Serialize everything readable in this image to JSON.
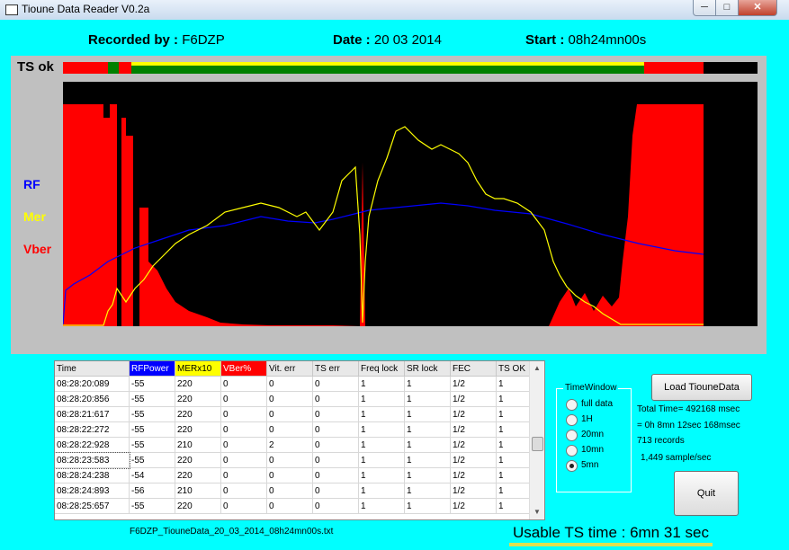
{
  "window": {
    "title": "Tioune Data Reader V0.2a",
    "min_icon": "minimize-icon",
    "max_icon": "maximize-icon",
    "close_icon": "close-icon"
  },
  "header": {
    "recorded_by_label": "Recorded by :",
    "recorded_by_value": "F6DZP",
    "date_label": "Date :",
    "date_value": "20 03 2014",
    "start_label": "Start :",
    "start_value": "08h24mn00s"
  },
  "plot": {
    "ts_label": "TS ok",
    "rf_label": "RF",
    "mer_label": "Mer",
    "vber_label": "Vber",
    "colors": {
      "rf": "#0000ff",
      "mer": "#ffff00",
      "vber": "#ff0000",
      "bg": "#000000",
      "ts_ok": "#008000",
      "ts_bad": "#ff0000"
    }
  },
  "table": {
    "headers": [
      "Time",
      "RFPower",
      "MERx10",
      "VBer%",
      "Vit. err",
      "TS err",
      "Freq lock",
      "SR lock",
      "FEC",
      "TS OK"
    ],
    "header_colors": [
      "",
      "#0000ff",
      "#ffff00",
      "#ff0000",
      "",
      "",
      "",
      "",
      "",
      ""
    ],
    "rows": [
      [
        "08:28:20:089",
        "-55",
        "220",
        "0",
        "0",
        "0",
        "1",
        "1",
        "1/2",
        "1"
      ],
      [
        "08:28:20:856",
        "-55",
        "220",
        "0",
        "0",
        "0",
        "1",
        "1",
        "1/2",
        "1"
      ],
      [
        "08:28:21:617",
        "-55",
        "220",
        "0",
        "0",
        "0",
        "1",
        "1",
        "1/2",
        "1"
      ],
      [
        "08:28:22:272",
        "-55",
        "220",
        "0",
        "0",
        "0",
        "1",
        "1",
        "1/2",
        "1"
      ],
      [
        "08:28:22:928",
        "-55",
        "210",
        "0",
        "2",
        "0",
        "1",
        "1",
        "1/2",
        "1"
      ],
      [
        "08:28:23:583",
        "-55",
        "220",
        "0",
        "0",
        "0",
        "1",
        "1",
        "1/2",
        "1"
      ],
      [
        "08:28:24:238",
        "-54",
        "220",
        "0",
        "0",
        "0",
        "1",
        "1",
        "1/2",
        "1"
      ],
      [
        "08:28:24:893",
        "-56",
        "210",
        "0",
        "0",
        "0",
        "1",
        "1",
        "1/2",
        "1"
      ],
      [
        "08:28:25:657",
        "-55",
        "220",
        "0",
        "0",
        "0",
        "1",
        "1",
        "1/2",
        "1"
      ]
    ]
  },
  "file_label": "F6DZP_TiouneData_20_03_2014_08h24mn00s.txt",
  "usable": "Usable TS time : 6mn 31 sec",
  "time_window": {
    "title": "TimeWindow",
    "options": [
      {
        "label": "full data",
        "selected": false
      },
      {
        "label": "1H",
        "selected": false
      },
      {
        "label": "20mn",
        "selected": false
      },
      {
        "label": "10mn",
        "selected": false
      },
      {
        "label": "5mn",
        "selected": true
      }
    ]
  },
  "buttons": {
    "load": "Load TiouneData",
    "quit": "Quit"
  },
  "stats": {
    "total_time": "Total Time= 492168 msec",
    "breakdown": "= 0h 8mn 12sec 168msec",
    "records": "713 records",
    "rate": "1,449 sample/sec"
  }
}
